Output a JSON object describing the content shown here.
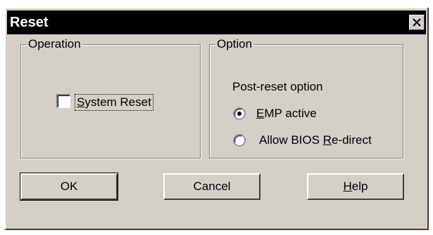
{
  "window": {
    "title": "Reset"
  },
  "operation": {
    "group_label": "Operation",
    "system_reset": {
      "label_pre": "",
      "label_mnemonic": "S",
      "label_post": "ystem Reset",
      "checked": false
    }
  },
  "option": {
    "group_label": "Option",
    "caption": "Post-reset option",
    "radios": [
      {
        "label_pre": "",
        "label_mnemonic": "E",
        "label_post": "MP active",
        "selected": true
      },
      {
        "label_pre": "Allow BIOS ",
        "label_mnemonic": "R",
        "label_post": "e-direct",
        "selected": false
      }
    ]
  },
  "buttons": {
    "ok": "OK",
    "cancel": "Cancel",
    "help_mnemonic": "H",
    "help_rest": "elp"
  },
  "icons": {
    "close": "close-icon",
    "radio_selected": "radio-selected-icon",
    "radio_unselected": "radio-unselected-icon"
  },
  "colors": {
    "face": "#d4d0c8",
    "titlebar": "#000000",
    "title_text": "#ffffff"
  }
}
